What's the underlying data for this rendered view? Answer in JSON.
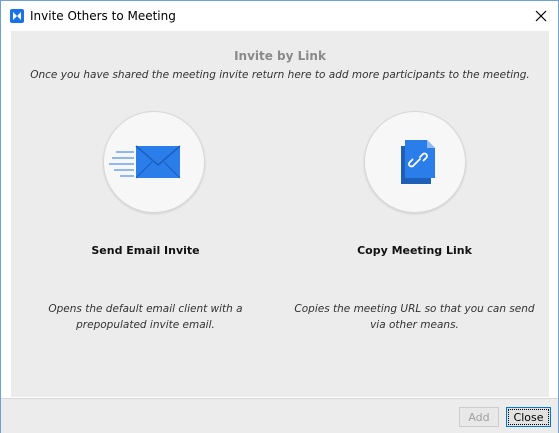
{
  "window": {
    "title": "Invite Others to Meeting"
  },
  "header": {
    "heading": "Invite by Link",
    "subheading": "Once you have shared the meeting invite return here to add more participants to the meeting."
  },
  "options": [
    {
      "title": "Send Email Invite",
      "description": "Opens the default email client with a prepopulated invite email.",
      "icon": "email-envelope-icon"
    },
    {
      "title": "Copy Meeting Link",
      "description": "Copies the meeting URL so that you can send via other means.",
      "icon": "document-link-icon"
    }
  ],
  "footer": {
    "add_label": "Add",
    "close_label": "Close"
  },
  "colors": {
    "accent": "#2b7de9",
    "content_bg": "#ececec",
    "heading_gray": "#8a8a8a"
  }
}
